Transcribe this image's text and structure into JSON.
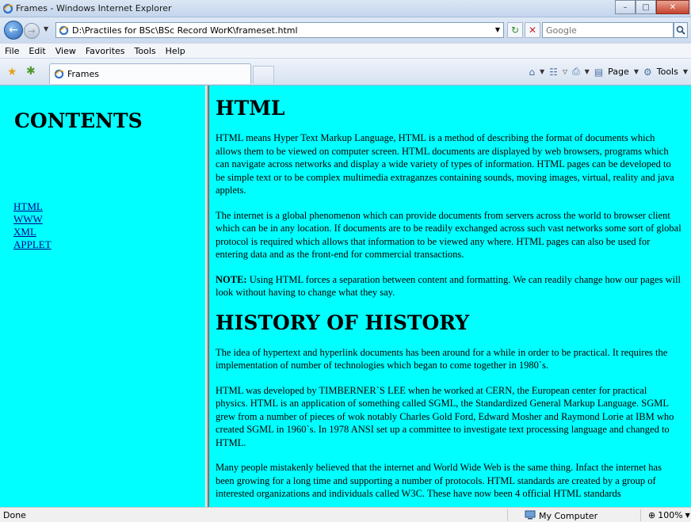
{
  "window": {
    "title": "Frames - Windows Internet Explorer",
    "controls": [
      "minimize-icon",
      "maximize-icon",
      "close-icon"
    ]
  },
  "address": {
    "url": "D:\\Practiles for BSc\\BSc Record WorK\\frameset.html",
    "search_placeholder": "Google"
  },
  "menu": {
    "items": [
      "File",
      "Edit",
      "View",
      "Favorites",
      "Tools",
      "Help"
    ]
  },
  "tabs": {
    "active_label": "Frames"
  },
  "command_bar": {
    "page_label": "Page",
    "tools_label": "Tools",
    "icons": [
      "home-icon",
      "feeds-icon",
      "print-icon",
      "page-icon",
      "tools-gear-icon"
    ]
  },
  "left_frame": {
    "heading": "CONTENTS",
    "links": [
      "HTML",
      "WWW",
      "XML",
      "APPLET"
    ]
  },
  "right_frame": {
    "heading1": "HTML",
    "p1": "HTML means Hyper Text Markup Language, HTML is a method of describing the format of documents which allows them to be viewed on computer screen. HTML documents are displayed by web browsers, programs which can navigate across networks and display a wide variety of types of information. HTML pages can be developed to be simple text or to be complex multimedia extraganzes containing sounds, moving images, virtual, reality and java applets.",
    "p2": "The internet is a global phenomenon which can provide documents from servers across the world to browser client which can be in any location. If documents are to be readily exchanged across such vast networks some sort of global protocol is required which allows that information to be viewed any where. HTML pages can also be used for entering data and as the front-end for commercial transactions.",
    "note_label": "NOTE:",
    "note_text": " Using HTML forces a separation between content and formatting. We can readily change how our pages will look without having to change what they say.",
    "heading2": "HISTORY OF HISTORY",
    "p3": "The idea of hypertext and hyperlink documents has been around for a while in order to be practical. It requires the implementation of number of technologies which began to come together in 1980`s.",
    "p4": "HTML was developed by TIMBERNER`S LEE when he worked at CERN, the European center for practical physics. HTML is an application of something called SGML, the Standardized General Markup Language. SGML grew from a number of pieces of wok notably Charles Gold Ford, Edward Mosher and Raymond Lorie at IBM who created SGML in 1960`s. In 1978 ANSI set up a committee to investigate text processing language and changed to HTML.",
    "p5": "Many people mistakenly believed that the internet and World Wide Web is the same thing. Infact the internet has been growing for a long time and supporting a number of protocols. HTML standards are created by a group of interested organizations and individuals called W3C. These have now been 4 official HTML standards"
  },
  "status": {
    "text": "Done",
    "zone": "My Computer",
    "zoom": "100%"
  },
  "colors": {
    "frame_background": "#00ffff",
    "link": "#00008b"
  }
}
